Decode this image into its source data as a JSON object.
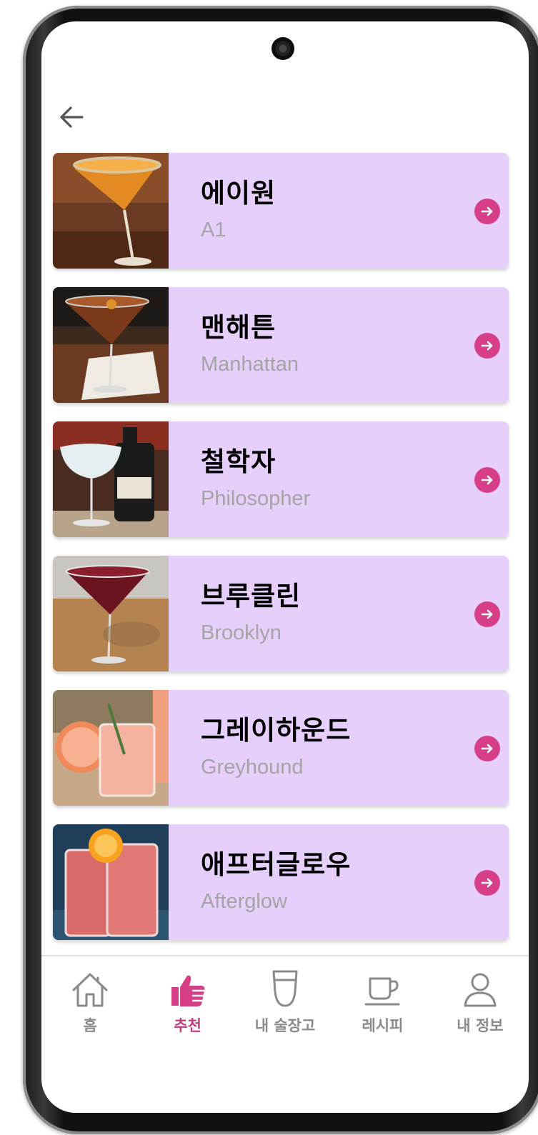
{
  "header": {
    "back_icon": "arrow-left-icon"
  },
  "cocktails": [
    {
      "name_ko": "에이원",
      "name_en": "A1"
    },
    {
      "name_ko": "맨해튼",
      "name_en": "Manhattan"
    },
    {
      "name_ko": "철학자",
      "name_en": "Philosopher"
    },
    {
      "name_ko": "브루클린",
      "name_en": "Brooklyn"
    },
    {
      "name_ko": "그레이하운드",
      "name_en": "Greyhound"
    },
    {
      "name_ko": "애프터글로우",
      "name_en": "Afterglow"
    }
  ],
  "nav": {
    "items": [
      {
        "label": "홈",
        "icon": "home-icon"
      },
      {
        "label": "추천",
        "icon": "thumbs-up-icon",
        "active": true
      },
      {
        "label": "내 술장고",
        "icon": "glass-icon"
      },
      {
        "label": "레시피",
        "icon": "cup-icon"
      },
      {
        "label": "내 정보",
        "icon": "user-icon"
      }
    ]
  },
  "colors": {
    "card_bg": "#e6d0fb",
    "accent": "#d63f87",
    "active_nav": "#c43a7f",
    "subtitle": "#a4a4a4"
  }
}
